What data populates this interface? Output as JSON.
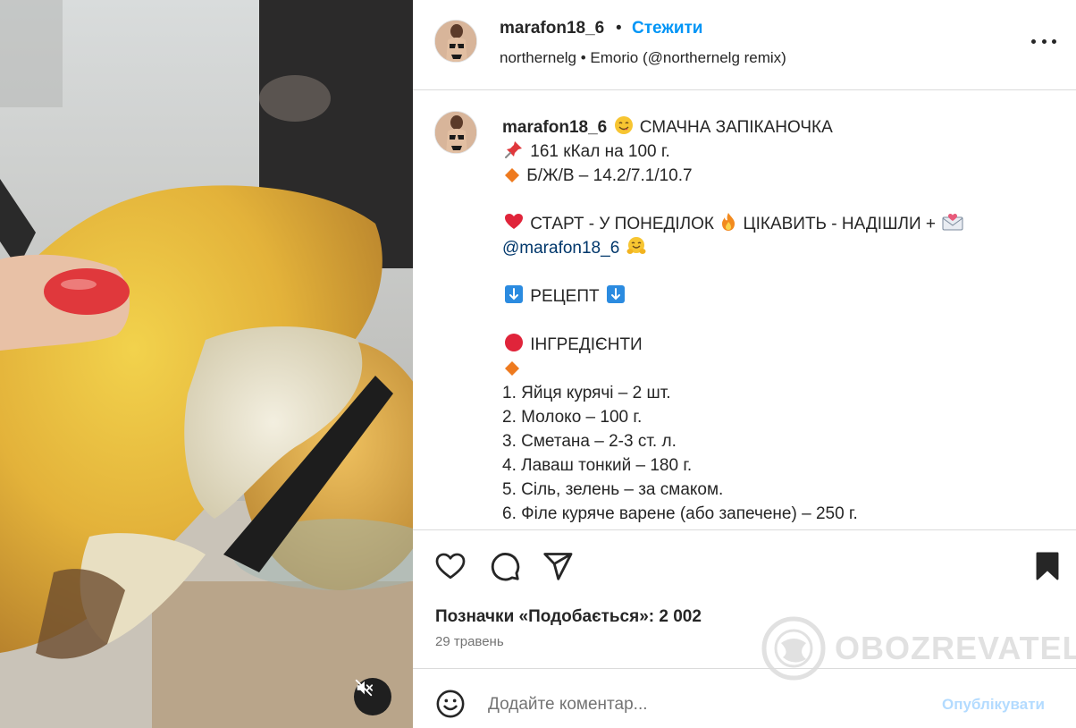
{
  "header": {
    "username": "marafon18_6",
    "dot": "•",
    "follow_label": "Стежити",
    "audio": "northernelg • Emorio (@northernelg remix)"
  },
  "caption": {
    "username": "marafon18_6",
    "title": "СМАЧНА ЗАПІКАНОЧКА",
    "calories": "161 кКал на 100 г.",
    "macros": "Б/Ж/В – 14.2/7.1/10.7",
    "start_a": "СТАРТ - У ПОНЕДІЛОК",
    "start_b": "ЦІКАВИТЬ - НАДІШЛИ +",
    "mention": "@marafon18_6",
    "recipe": "РЕЦЕПТ",
    "ingredients_title": "ІНГРЕДІЄНТИ",
    "ingredients": [
      "1. Яйця курячі – 2 шт.",
      "2. Молоко – 100 г.",
      "3. Сметана – 2-3 ст. л.",
      "4. Лаваш тонкий – 180 г.",
      "5. Сіль, зелень – за смаком.",
      "6. Філе куряче варене (або запечене) – 250 г."
    ]
  },
  "icons": {
    "like": "heart-outline-icon",
    "comment": "speech-bubble-icon",
    "share": "paper-plane-icon",
    "save": "bookmark-filled-icon",
    "more": "three-dots-icon",
    "mute": "speaker-muted-icon",
    "emoji": "smiley-icon"
  },
  "stats": {
    "likes": "Позначки «Подобається»: 2 002",
    "date": "29 травень"
  },
  "watermark": {
    "text": "OBOZREVATEL"
  },
  "comment": {
    "placeholder": "Додайте коментар...",
    "publish_label": "Опублікувати"
  },
  "colors": {
    "link_blue": "#0095f6",
    "publish_disabled": "#b3dbff",
    "mention": "#00376b",
    "text": "#262626",
    "muted": "#737373",
    "divider": "#dbdbdb"
  }
}
